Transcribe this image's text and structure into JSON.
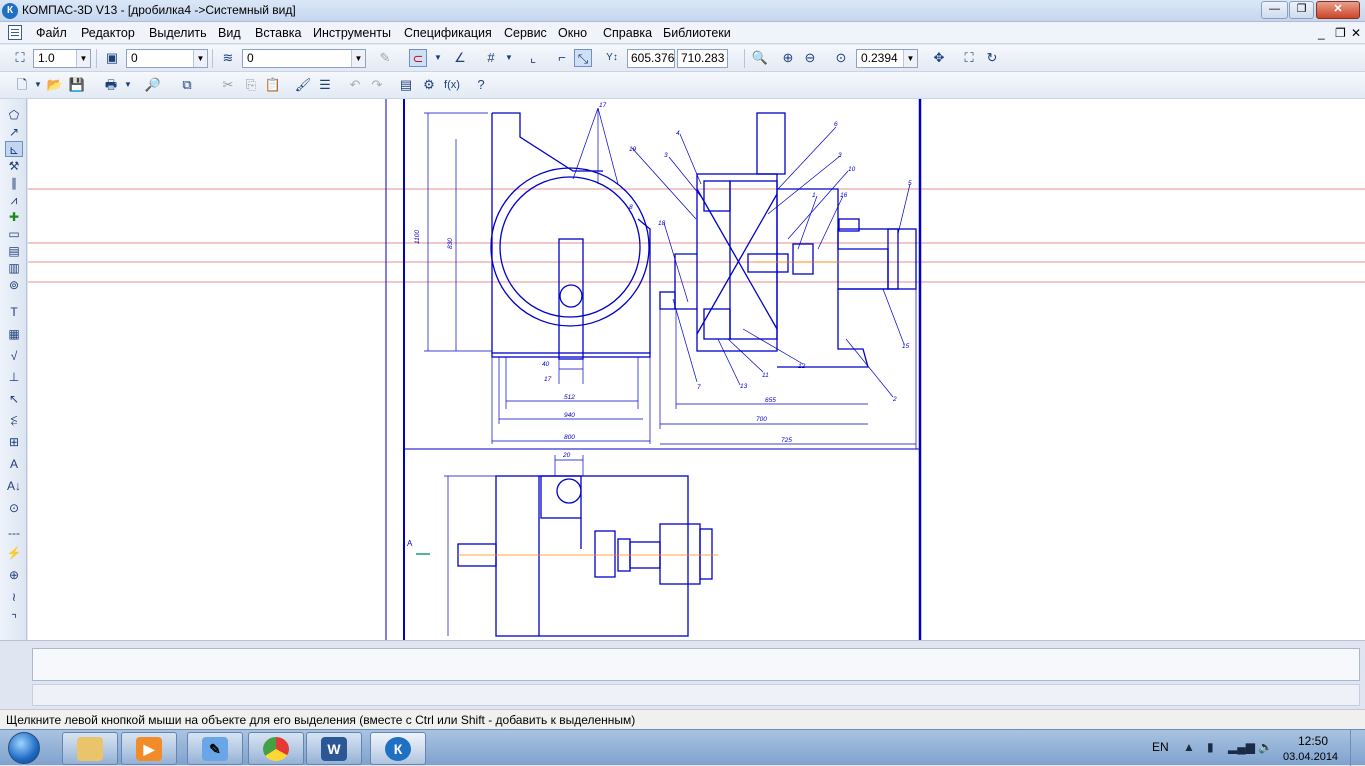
{
  "window": {
    "title": "КОМПАС-3D V13 - [дробилка4 ->Системный вид]",
    "app_icon": "К",
    "controls": {
      "minimize": "—",
      "restore": "❐",
      "close": "✕"
    }
  },
  "menubar": {
    "items": [
      "Файл",
      "Редактор",
      "Выделить",
      "Вид",
      "Вставка",
      "Инструменты",
      "Спецификация",
      "Сервис",
      "Окно",
      "Справка",
      "Библиотеки"
    ],
    "doc_controls": {
      "minimize": "_",
      "restore": "❐",
      "close": "✕"
    }
  },
  "toolbar1": {
    "scale_value": "1.0",
    "layer_value": "0",
    "style_value": "0",
    "coord_x": "605.376",
    "coord_y": "710.283",
    "zoom_value": "0.2394"
  },
  "drawing": {
    "line_color": "#0000c8",
    "accent_color": "#ff8c00",
    "callouts": [
      "17",
      "19",
      "3",
      "4",
      "6",
      "5",
      "3",
      "10",
      "1",
      "16",
      "15",
      "7",
      "13",
      "11",
      "12",
      "2",
      "18",
      "8"
    ],
    "dims": [
      "1100",
      "830",
      "40",
      "17",
      "512",
      "940",
      "800",
      "655",
      "700",
      "725",
      "20"
    ],
    "section_label": "A"
  },
  "status": {
    "hint": "Щелкните левой кнопкой мыши на объекте для его выделения (вместе с Ctrl или Shift - добавить к выделенным)"
  },
  "taskbar": {
    "lang": "EN",
    "time": "12:50",
    "date": "03.04.2014"
  }
}
